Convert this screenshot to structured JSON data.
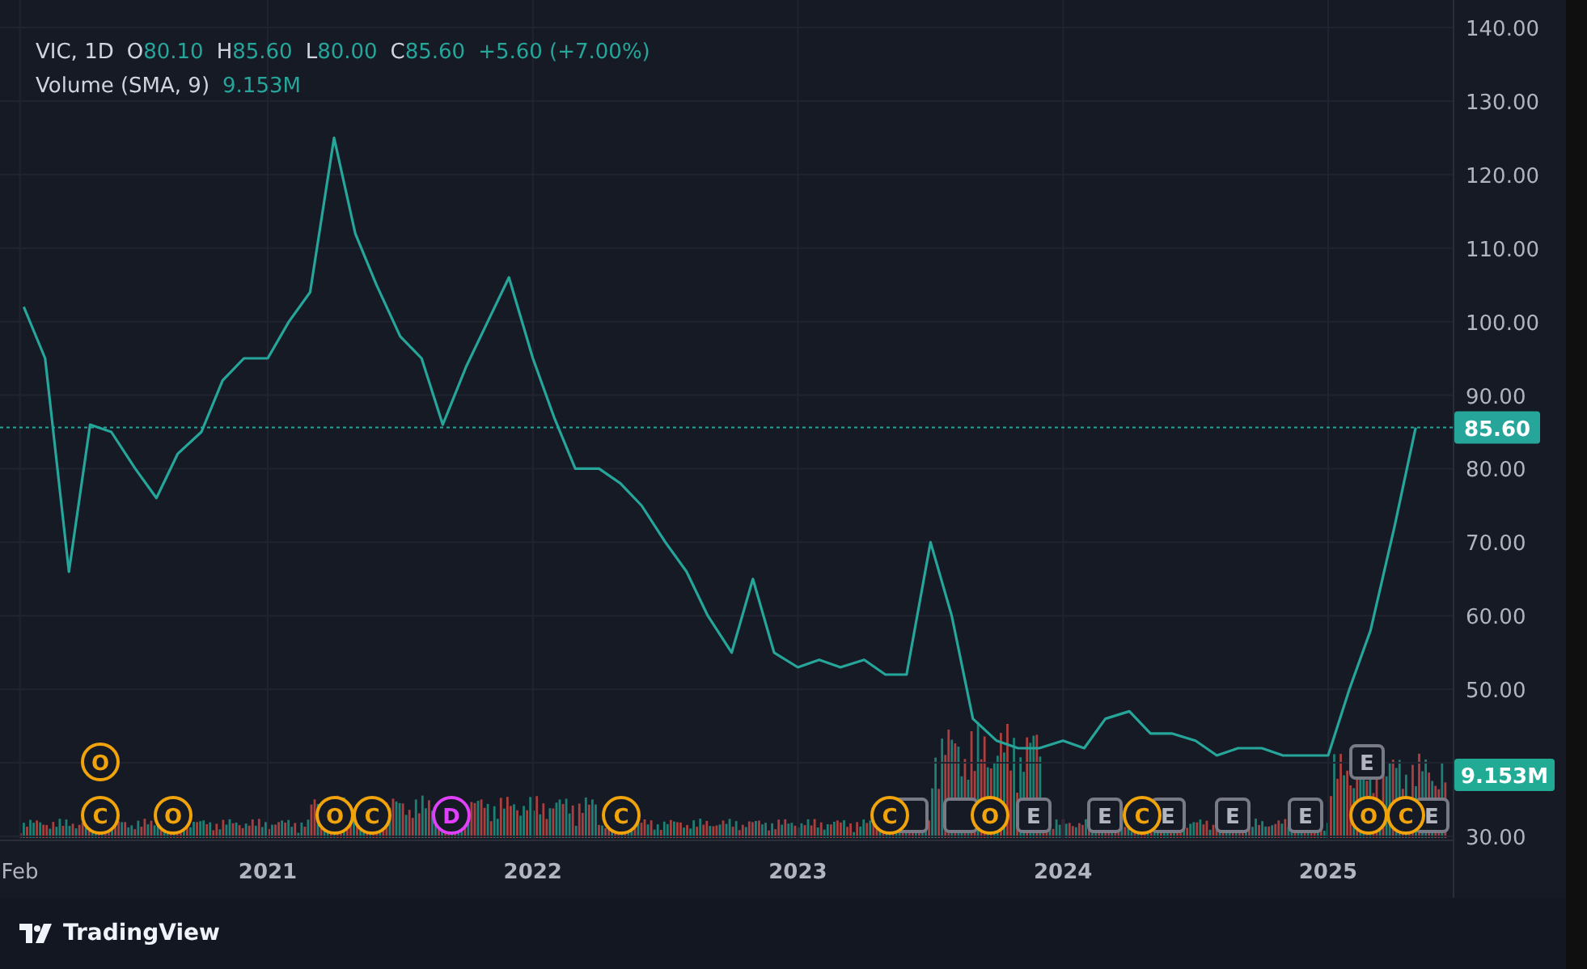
{
  "legend": {
    "symbol": "VIC, 1D",
    "ohlc": [
      {
        "label": "O",
        "value": "80.10"
      },
      {
        "label": "H",
        "value": "85.60"
      },
      {
        "label": "L",
        "value": "80.00"
      },
      {
        "label": "C",
        "value": "85.60"
      }
    ],
    "change": "+5.60 (+7.00%)",
    "indicator": "Volume (SMA, 9)",
    "indicator_value": "9.153M"
  },
  "chart_data": {
    "type": "line",
    "grid": true,
    "x": [
      2020.08,
      2020.16,
      2020.25,
      2020.33,
      2020.41,
      2020.5,
      2020.58,
      2020.66,
      2020.75,
      2020.83,
      2020.91,
      2021,
      2021.08,
      2021.16,
      2021.25,
      2021.33,
      2021.41,
      2021.5,
      2021.58,
      2021.66,
      2021.75,
      2021.83,
      2021.91,
      2022,
      2022.08,
      2022.16,
      2022.25,
      2022.33,
      2022.41,
      2022.5,
      2022.58,
      2022.66,
      2022.75,
      2022.83,
      2022.91,
      2023,
      2023.08,
      2023.16,
      2023.25,
      2023.33,
      2023.41,
      2023.5,
      2023.58,
      2023.66,
      2023.75,
      2023.83,
      2023.91,
      2024,
      2024.08,
      2024.16,
      2024.25,
      2024.33,
      2024.41,
      2024.5,
      2024.58,
      2024.66,
      2024.75,
      2024.83,
      2024.91,
      2025,
      2025.08,
      2025.16,
      2025.25,
      2025.33
    ],
    "series": [
      {
        "color": "#26a69a",
        "values": [
          102,
          95,
          66,
          86,
          85,
          80,
          76,
          82,
          85,
          92,
          95,
          95,
          100,
          104,
          125,
          112,
          105,
          98,
          95,
          86,
          94,
          100,
          106,
          95,
          87,
          80,
          80,
          78,
          75,
          70,
          66,
          60,
          55,
          65,
          55,
          53,
          54,
          53,
          54,
          52,
          52,
          70,
          60,
          46,
          43,
          42,
          42,
          43,
          42,
          46,
          47,
          44,
          44,
          43,
          41,
          42,
          42,
          41,
          41,
          41,
          50,
          58,
          72,
          85.6
        ]
      }
    ],
    "xlim": [
      2019.99,
      2025.47
    ],
    "ylim": [
      30,
      140
    ],
    "yticks": [
      {
        "value": 30,
        "label": "30.00"
      },
      {
        "value": 50,
        "label": "50.00"
      },
      {
        "value": 60,
        "label": "60.00"
      },
      {
        "value": 70,
        "label": "70.00"
      },
      {
        "value": 80,
        "label": "80.00"
      },
      {
        "value": 90,
        "label": "90.00"
      },
      {
        "value": 100,
        "label": "100.00"
      },
      {
        "value": 110,
        "label": "110.00"
      },
      {
        "value": 120,
        "label": "120.00"
      },
      {
        "value": 130,
        "label": "130.00"
      },
      {
        "value": 140,
        "label": "140.00"
      }
    ],
    "xticks": [
      {
        "value": 2020.065,
        "label": "Feb"
      },
      {
        "value": 2021,
        "label": "2021"
      },
      {
        "value": 2022,
        "label": "2022"
      },
      {
        "value": 2023,
        "label": "2023"
      },
      {
        "value": 2024,
        "label": "2024"
      },
      {
        "value": 2025,
        "label": "2025"
      }
    ],
    "ref_lines": [
      {
        "axis": "y",
        "value": 85.6,
        "label": "85.60",
        "color": "#26a69a"
      }
    ]
  },
  "events": [
    {
      "kind": "circle",
      "letter": "O",
      "color": "#f0a30a"
    },
    {
      "kind": "square",
      "letter": "E",
      "color": "#787b86"
    },
    {
      "kind": "circle",
      "letter": "C",
      "color": "#f0a30a"
    },
    {
      "kind": "circle",
      "letter": "O",
      "color": "#f0a30a"
    },
    {
      "kind": "circle",
      "letter": "O",
      "color": "#f0a30a"
    },
    {
      "kind": "circle",
      "letter": "C",
      "color": "#f0a30a"
    },
    {
      "kind": "circle",
      "letter": "D",
      "color": "#e040fb"
    },
    {
      "kind": "circle",
      "letter": "C",
      "color": "#f0a30a"
    },
    {
      "kind": "circle",
      "letter": "C",
      "color": "#f0a30a"
    },
    {
      "kind": "square",
      "color": "#787b86"
    },
    {
      "kind": "square",
      "color": "#787b86"
    },
    {
      "kind": "circle",
      "letter": "O",
      "color": "#f0a30a"
    },
    {
      "kind": "square",
      "letter": "E",
      "color": "#787b86"
    },
    {
      "kind": "square",
      "letter": "E",
      "color": "#787b86"
    },
    {
      "kind": "circle",
      "letter": "C",
      "color": "#f0a30a"
    },
    {
      "kind": "square",
      "letter": "E",
      "color": "#787b86"
    },
    {
      "kind": "square",
      "letter": "E",
      "color": "#787b86"
    },
    {
      "kind": "square",
      "letter": "E",
      "color": "#787b86"
    },
    {
      "kind": "circle",
      "letter": "O",
      "color": "#f0a30a"
    },
    {
      "kind": "circle",
      "letter": "C",
      "color": "#f0a30a"
    },
    {
      "kind": "square",
      "letter": "E",
      "color": "#787b86"
    }
  ],
  "volume_label": "9.153M",
  "footer": {
    "brand": "TradingView"
  }
}
